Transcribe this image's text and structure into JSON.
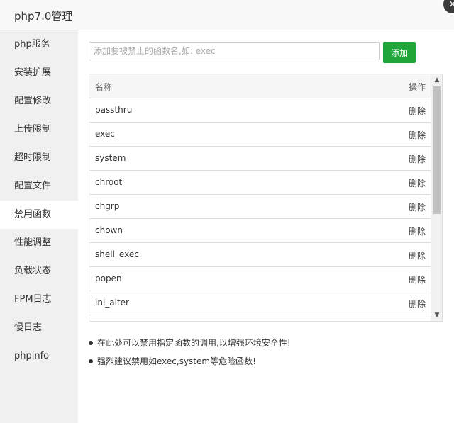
{
  "window": {
    "title": "php7.0管理",
    "close_glyph": "×"
  },
  "sidebar": {
    "items": [
      {
        "label": "php服务",
        "active": false
      },
      {
        "label": "安装扩展",
        "active": false
      },
      {
        "label": "配置修改",
        "active": false
      },
      {
        "label": "上传限制",
        "active": false
      },
      {
        "label": "超时限制",
        "active": false
      },
      {
        "label": "配置文件",
        "active": false
      },
      {
        "label": "禁用函数",
        "active": true
      },
      {
        "label": "性能调整",
        "active": false
      },
      {
        "label": "负载状态",
        "active": false
      },
      {
        "label": "FPM日志",
        "active": false
      },
      {
        "label": "慢日志",
        "active": false
      },
      {
        "label": "phpinfo",
        "active": false
      }
    ]
  },
  "toolbar": {
    "input_value": "",
    "input_placeholder": "添加要被禁止的函数名,如: exec",
    "add_label": "添加",
    "add_color": "#20a53a"
  },
  "table": {
    "columns": {
      "name": "名称",
      "action": "操作"
    },
    "rows": [
      {
        "name": "passthru",
        "action": "删除"
      },
      {
        "name": "exec",
        "action": "删除"
      },
      {
        "name": "system",
        "action": "删除"
      },
      {
        "name": "chroot",
        "action": "删除"
      },
      {
        "name": "chgrp",
        "action": "删除"
      },
      {
        "name": "chown",
        "action": "删除"
      },
      {
        "name": "shell_exec",
        "action": "删除"
      },
      {
        "name": "popen",
        "action": "删除"
      },
      {
        "name": "ini_alter",
        "action": "删除"
      }
    ],
    "scroll_up_glyph": "▲",
    "scroll_down_glyph": "▼"
  },
  "tips": [
    "在此处可以禁用指定函数的调用,以增强环境安全性!",
    "强烈建议禁用如exec,system等危险函数!"
  ]
}
